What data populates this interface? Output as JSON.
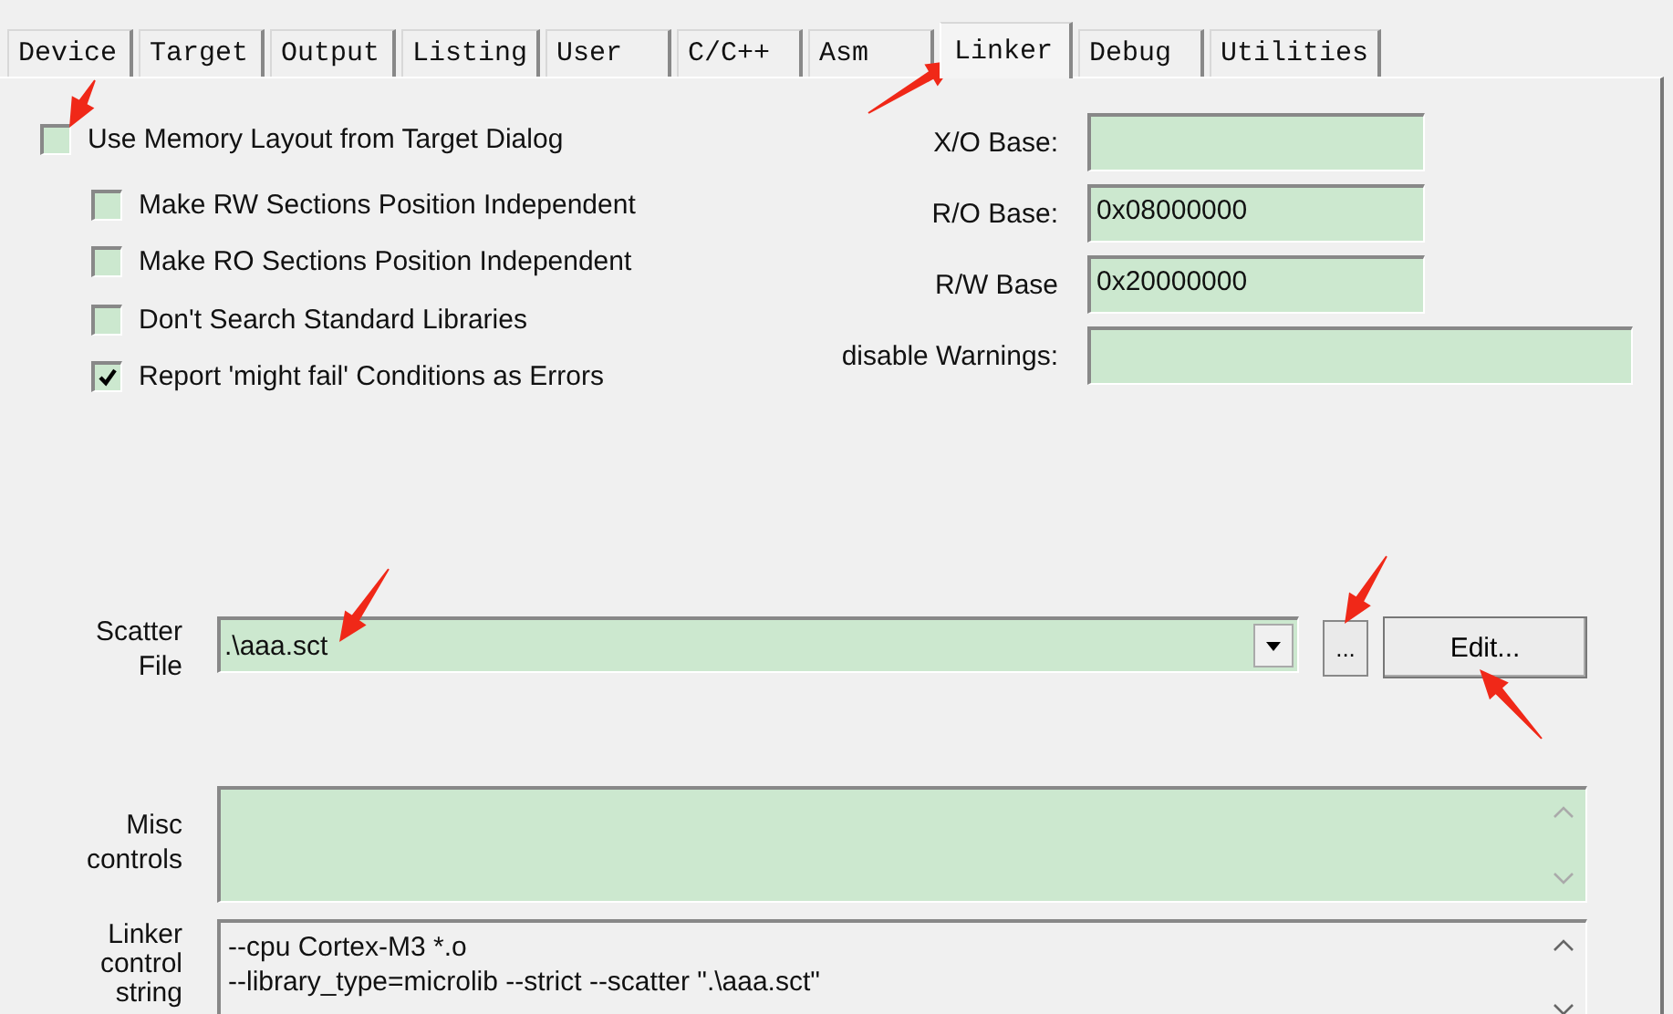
{
  "tabs": [
    {
      "label": "Device",
      "selected": false
    },
    {
      "label": "Target",
      "selected": false
    },
    {
      "label": "Output",
      "selected": false
    },
    {
      "label": "Listing",
      "selected": false
    },
    {
      "label": "User",
      "selected": false
    },
    {
      "label": "C/C++",
      "selected": false
    },
    {
      "label": "Asm",
      "selected": false
    },
    {
      "label": "Linker",
      "selected": true
    },
    {
      "label": "Debug",
      "selected": false
    },
    {
      "label": "Utilities",
      "selected": false
    }
  ],
  "memory_layout_option": {
    "label": "Use Memory Layout from Target Dialog",
    "checked": false,
    "children": [
      {
        "label": "Make RW Sections Position Independent",
        "checked": false
      },
      {
        "label": "Make RO Sections Position Independent",
        "checked": false
      },
      {
        "label": "Don't Search Standard Libraries",
        "checked": false
      },
      {
        "label": "Report 'might fail' Conditions as Errors",
        "checked": true
      }
    ]
  },
  "address_fields": [
    {
      "label": "X/O Base:",
      "kind": "short"
    },
    {
      "label": "R/O Base:",
      "value": "0x08000000",
      "kind": "short"
    },
    {
      "label": "R/W Base",
      "value": "0x20000000",
      "kind": "short"
    },
    {
      "label": "disable Warnings:",
      "kind": "wide"
    }
  ],
  "scatter_file": {
    "label": "Scatter File",
    "value": ".\\aaa.sct",
    "browse_button": "...",
    "edit_button": "Edit..."
  },
  "misc_controls": {
    "label": "Misc controls"
  },
  "linker_control_string": {
    "label": "Linker control string",
    "lines": [
      "--cpu Cortex-M3 *.o",
      "--library_type=microlib --strict --scatter \".\\aaa.sct\""
    ]
  }
}
